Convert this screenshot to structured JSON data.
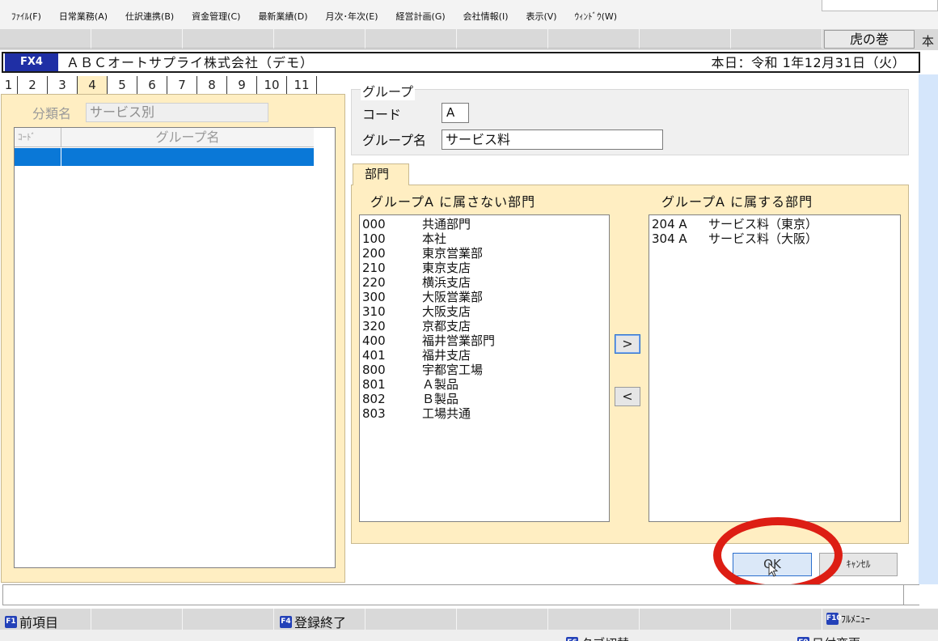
{
  "menu": [
    "ﾌｧｲﾙ(F)",
    "日常業務(A)",
    "仕訳連携(B)",
    "資金管理(C)",
    "最新業績(D)",
    "月次･年次(E)",
    "経営計画(G)",
    "会社情報(I)",
    "表示(V)",
    "ｳｨﾝﾄﾞｳ(W)"
  ],
  "toolbar": {
    "tora_label": "虎の巻",
    "right_edge_char": "本"
  },
  "titlebar": {
    "badge": "FX4",
    "company": "ＡＢＣオートサプライ株式会社（デモ）",
    "today": "本日：令和 1年12月31日（火）"
  },
  "tabs": {
    "items": [
      "1",
      "2",
      "3",
      "4",
      "5",
      "6",
      "7",
      "8",
      "9",
      "10",
      "11"
    ],
    "active": "4"
  },
  "left": {
    "bunrui_label": "分類名",
    "bunrui_value": "サービス別",
    "col_code": "ｺｰﾄﾞ",
    "col_name": "グループ名"
  },
  "group": {
    "title": "グループ",
    "code_label": "コード",
    "code_value": "A",
    "name_label": "グループ名",
    "name_value": "サービス料"
  },
  "bumon": {
    "tab_label": "部門",
    "not_title": "グループA に属さない部門",
    "in_title": "グループA に属する部門",
    "not_items": [
      {
        "code": "000",
        "name": "共通部門"
      },
      {
        "code": "100",
        "name": "本社"
      },
      {
        "code": "200",
        "name": "東京営業部"
      },
      {
        "code": "210",
        "name": "東京支店"
      },
      {
        "code": "220",
        "name": "横浜支店"
      },
      {
        "code": "300",
        "name": "大阪営業部"
      },
      {
        "code": "310",
        "name": "大阪支店"
      },
      {
        "code": "320",
        "name": "京都支店"
      },
      {
        "code": "400",
        "name": "福井営業部門"
      },
      {
        "code": "401",
        "name": "福井支店"
      },
      {
        "code": "800",
        "name": "宇都宮工場"
      },
      {
        "code": "801",
        "name": "Ａ製品"
      },
      {
        "code": "802",
        "name": "Ｂ製品"
      },
      {
        "code": "803",
        "name": "工場共通"
      }
    ],
    "in_items": [
      {
        "code": "204 A",
        "name": "サービス料（東京）"
      },
      {
        "code": "304 A",
        "name": "サービス料（大阪）"
      }
    ],
    "move_right": ">",
    "move_left": "<"
  },
  "buttons": {
    "ok": "OK",
    "cancel": "ｷｬﾝｾﾙ"
  },
  "fkeys": [
    {
      "key": "F1",
      "label": "前項目"
    },
    {
      "key": "F4",
      "label": "登録終了"
    },
    {
      "key": "F10",
      "label": "ﾌﾙﾒﾆｭｰ"
    }
  ],
  "fkeys_row2": [
    {
      "key": "F6",
      "label": "タブ切替"
    },
    {
      "key": "F9",
      "label": "日付変更"
    }
  ],
  "colors": {
    "badge_bg": "#1f2fa5",
    "panel_bg": "#ffeec2",
    "selection": "#0a78d7",
    "highlight_ring": "#dd1e14",
    "side_blue": "#d5e6fb"
  }
}
